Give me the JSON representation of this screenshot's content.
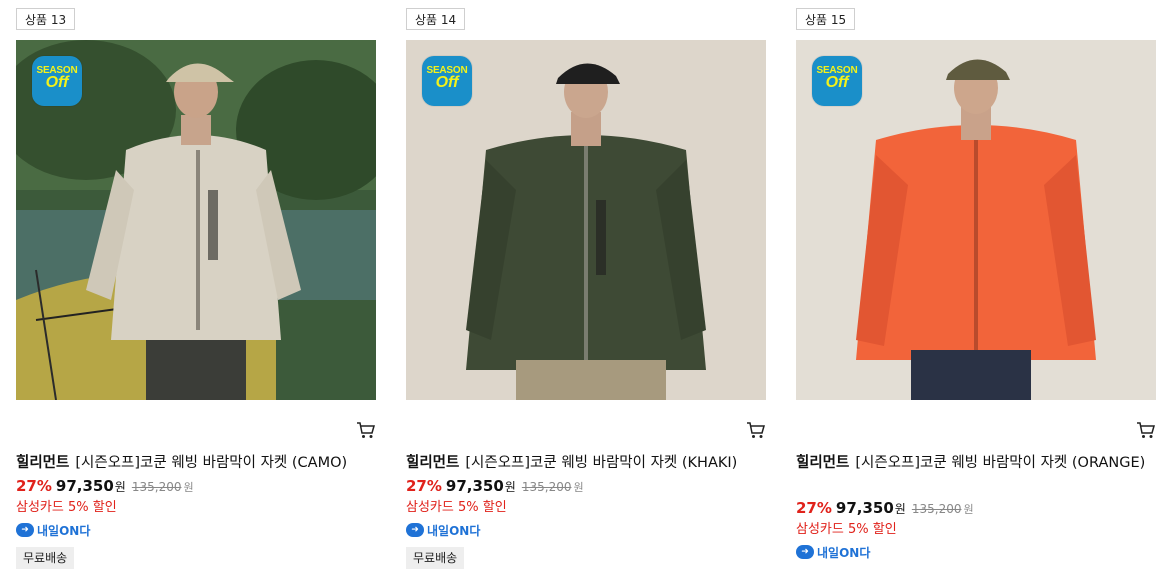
{
  "products": [
    {
      "badge": "상품 13",
      "season_top": "SEASON",
      "season_bottom": "Off",
      "brand": "힐리먼트",
      "name": "[시즌오프]코쿤 웨빙 바람막이 자켓 (CAMO)",
      "discount_rate": "27%",
      "price": "97,350",
      "currency": "원",
      "original_price": "135,200",
      "card_discount": "삼성카드 5% 할인",
      "delivery": "내일ON다",
      "shipping": "무료배송",
      "jacket_color": "#d8d2c4"
    },
    {
      "badge": "상품 14",
      "season_top": "SEASON",
      "season_bottom": "Off",
      "brand": "힐리먼트",
      "name": "[시즌오프]코쿤 웨빙 바람막이 자켓 (KHAKI)",
      "discount_rate": "27%",
      "price": "97,350",
      "currency": "원",
      "original_price": "135,200",
      "card_discount": "삼성카드 5% 할인",
      "delivery": "내일ON다",
      "shipping": "무료배송",
      "jacket_color": "#3e4a35"
    },
    {
      "badge": "상품 15",
      "season_top": "SEASON",
      "season_bottom": "Off",
      "brand": "힐리먼트",
      "name": "[시즌오프]코쿤 웨빙 바람막이 자켓 (ORANGE)",
      "discount_rate": "27%",
      "price": "97,350",
      "currency": "원",
      "original_price": "135,200",
      "card_discount": "삼성카드 5% 할인",
      "delivery": "내일ON다",
      "shipping": "",
      "jacket_color": "#f2643a"
    }
  ],
  "colors": {
    "accent_red": "#e0221b",
    "season_blue": "#1a8fc9",
    "season_yellow": "#f3f21a"
  }
}
